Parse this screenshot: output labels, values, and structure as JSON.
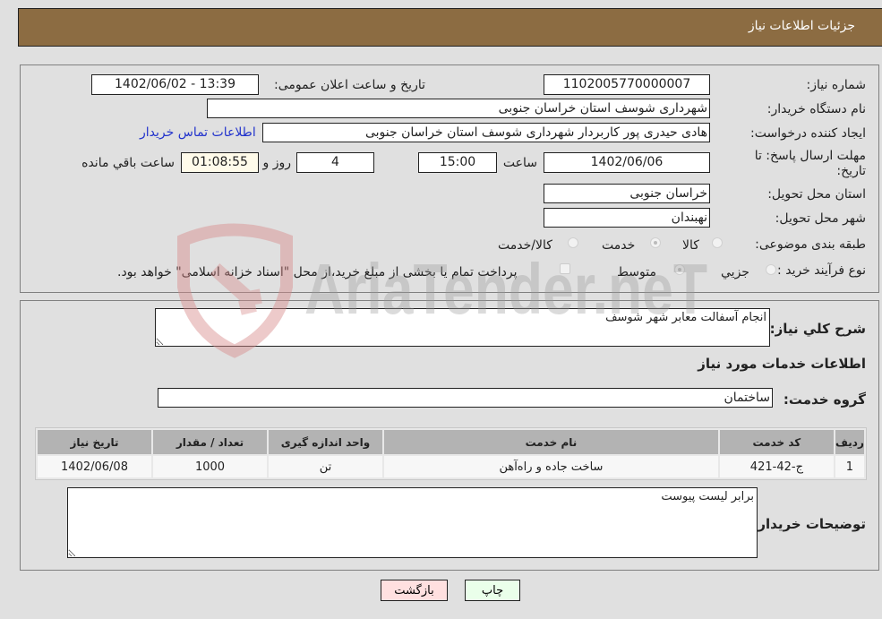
{
  "header": {
    "title": "جزئیات اطلاعات نیاز"
  },
  "form": {
    "need_number": {
      "label": "شماره نیاز:",
      "value": "1102005770000007"
    },
    "announce_datetime": {
      "label": "تاریخ و ساعت اعلان عمومی:",
      "value": "1402/06/02 - 13:39"
    },
    "buyer_org": {
      "label": "نام دستگاه خریدار:",
      "value": "شهرداری شوسف استان خراسان جنوبی"
    },
    "requester": {
      "label": "ایجاد کننده درخواست:",
      "value": "هادی حیدری پور کاربردار شهرداری شوسف استان خراسان جنوبی"
    },
    "buyer_contact_link": "اطلاعات تماس خریدار",
    "deadline": {
      "label_line1": "مهلت ارسال پاسخ: تا",
      "label_line2": "تاریخ:",
      "date": "1402/06/06",
      "time_label": "ساعت",
      "time": "15:00",
      "days": "4",
      "days_label": "روز و",
      "remaining": "01:08:55",
      "remaining_label": "ساعت باقي مانده"
    },
    "delivery_province": {
      "label": "استان محل تحویل:",
      "value": "خراسان جنوبی"
    },
    "delivery_city": {
      "label": "شهر محل تحویل:",
      "value": "نهبندان"
    },
    "category": {
      "label": "طبقه بندی موضوعی:",
      "options": [
        "کالا",
        "خدمت",
        "کالا/خدمت"
      ],
      "selected": "خدمت"
    },
    "purchase_type": {
      "label": "نوع فرآیند خرید :",
      "options": [
        "جزیي",
        "متوسط"
      ],
      "selected": "متوسط",
      "treasury_note": "پرداخت تمام یا بخشی از مبلغ خرید،از محل \"اسناد خزانه اسلامی\" خواهد بود.",
      "treasury_checked": false
    }
  },
  "details": {
    "summary_label": "شرح کلي نیاز:",
    "summary_value": "انجام آسفالت معابر شهر شوسف",
    "services_heading": "اطلاعات خدمات مورد نیاز",
    "service_group_label": "گروه خدمت:",
    "service_group_value": "ساختمان",
    "table": {
      "headers": [
        "ردیف",
        "کد خدمت",
        "نام خدمت",
        "واحد اندازه گیری",
        "تعداد / مقدار",
        "تاریخ نیاز"
      ],
      "rows": [
        [
          "1",
          "ج-42-421",
          "ساخت جاده و راه‌آهن",
          "تن",
          "1000",
          "1402/06/08"
        ]
      ]
    },
    "buyer_notes_label": "توضیحات خریدار:",
    "buyer_notes_value": "برابر لیست پیوست"
  },
  "buttons": {
    "print": "چاپ",
    "back": "بازگشت"
  },
  "watermark": {
    "text": "AriaTender.neT"
  },
  "colors": {
    "header_bg": "#8c6c42",
    "page_bg": "#e0e0e0",
    "link": "#2233cc",
    "print_btn_bg": "#eaffea",
    "back_btn_bg": "#ffe0e0",
    "remaining_bg": "#fffbea"
  }
}
